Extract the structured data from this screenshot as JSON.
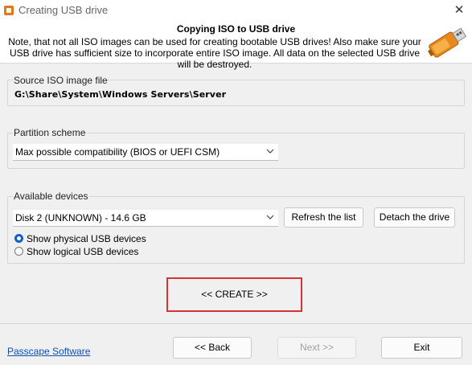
{
  "window": {
    "title": "Creating USB drive",
    "close_glyph": "✕"
  },
  "header": {
    "title": "Copying ISO to USB drive",
    "note": "Note, that not all ISO images can be used for creating bootable USB drives! Also make sure your USB drive has sufficient size to incorporate entire ISO image. All data on the selected USB drive will be destroyed.",
    "icon": "usb-drive-icon"
  },
  "source": {
    "label": "Source ISO image file",
    "value": "G:\\Share\\System\\Windows Servers\\Server"
  },
  "partition": {
    "label": "Partition scheme",
    "selected": "Max possible compatibility (BIOS or UEFI CSM)"
  },
  "devices": {
    "label": "Available devices",
    "selected": "Disk 2 (UNKNOWN) - 14.6 GB",
    "refresh_label": "Refresh the list",
    "detach_label": "Detach the drive",
    "radio_physical": "Show physical USB devices",
    "radio_logical": "Show logical USB devices",
    "physical_selected": true
  },
  "create": {
    "label": "<< CREATE >>"
  },
  "footer": {
    "link": "Passcape Software",
    "back_label": "<< Back",
    "next_label": "Next >>",
    "exit_label": "Exit"
  },
  "colors": {
    "accent": "#1060c8",
    "highlight_border": "#d63333",
    "link": "#0a4fb4"
  }
}
